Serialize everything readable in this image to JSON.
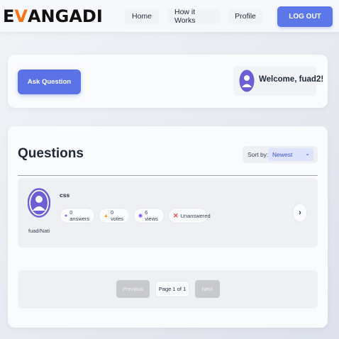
{
  "header": {
    "logo_prefix": "E",
    "logo_v": "V",
    "logo_suffix": "ANGADI",
    "nav": {
      "home": "Home",
      "how_it_works": "How it Works",
      "profile": "Profile"
    },
    "logout_label": "LOG OUT"
  },
  "top": {
    "ask_label": "Ask Question",
    "welcome": "Welcome, fuad2!"
  },
  "questions": {
    "title": "Questions",
    "sort_label": "Sort by:",
    "sort_selected": "Newest",
    "items": [
      {
        "username": "fuad/Nati",
        "subject": "css",
        "answers": "0 answers",
        "votes": "0 votes",
        "views": "6 views",
        "status": "Unanswered"
      }
    ]
  },
  "pagination": {
    "previous": "Previous",
    "info": "Page 1 of 1",
    "next": "Next"
  },
  "colors": {
    "accent": "#5b77e8",
    "logo_v": "#f97316",
    "avatar": "#6d5fd3",
    "unanswered": "#ef4444"
  },
  "icons": {
    "answers": "chat-bubble-icon",
    "votes": "thumbs-up-icon",
    "views": "eye-icon",
    "status": "x-icon",
    "next_arrow": "chevron-right-icon"
  }
}
